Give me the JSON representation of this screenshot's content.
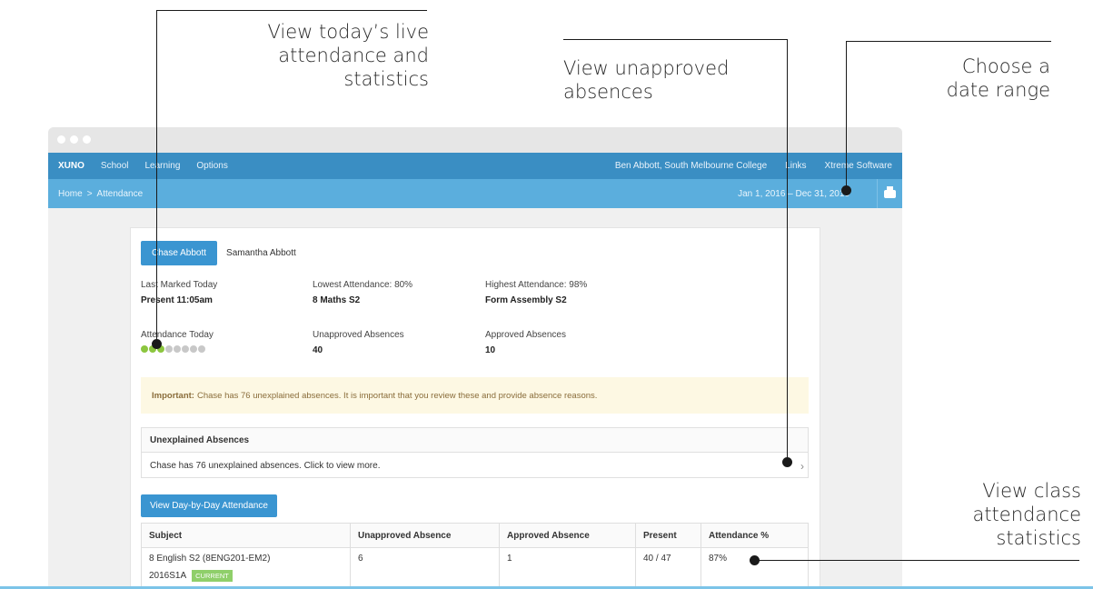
{
  "callouts": {
    "live": [
      "View today’s live",
      "attendance and",
      "statistics"
    ],
    "unapproved": [
      "View unapproved",
      "absences"
    ],
    "daterange": [
      "Choose a",
      "date range"
    ],
    "classstats": [
      "View class",
      "attendance",
      "statistics"
    ]
  },
  "topnav": {
    "brand": "XUNO",
    "links": [
      "School",
      "Learning",
      "Options"
    ],
    "user": "Ben Abbott, South Melbourne College",
    "links_right": [
      "Links",
      "Xtreme Software"
    ]
  },
  "subnav": {
    "breadcrumb": [
      "Home",
      "Attendance"
    ],
    "separator": ">",
    "date_range": "Jan 1, 2016 – Dec 31, 2016"
  },
  "tabs": {
    "active": "Chase Abbott",
    "other": "Samantha Abbott"
  },
  "stats": {
    "last_marked_label": "Last Marked Today",
    "last_marked_value": "Present 11:05am",
    "lowest_label": "Lowest Attendance: 80%",
    "lowest_value": "8 Maths S2",
    "highest_label": "Highest Attendance: 98%",
    "highest_value": "Form Assembly S2",
    "today_label": "Attendance Today",
    "unapproved_label": "Unapproved Absences",
    "unapproved_value": "40",
    "approved_label": "Approved Absences",
    "approved_value": "10"
  },
  "attendance_dots": {
    "present": 3,
    "total": 8,
    "present_color": "#8cc63f",
    "empty_color": "#c8c8c8"
  },
  "alert": {
    "strong": "Important:",
    "text": "Chase has 76 unexplained absences. It is important that you review these and provide absence reasons."
  },
  "unexplained": {
    "title": "Unexplained Absences",
    "text": "Chase has 76 unexplained absences. Click to view more."
  },
  "day_button": "View Day-by-Day Attendance",
  "table": {
    "headers": [
      "Subject",
      "Unapproved Absence",
      "Approved Absence",
      "Present",
      "Attendance %"
    ],
    "rows": [
      {
        "subject": "8 English S2 (8ENG201-EM2)",
        "code": "2016S1A",
        "badge": "CURRENT",
        "unapproved": "6",
        "approved": "1",
        "present": "40 / 47",
        "attendance": "87%"
      }
    ]
  },
  "colors": {
    "nav": "#3a8ec3",
    "subnav": "#5baedd",
    "button": "#3a95d1",
    "badge": "#8fcf6a"
  }
}
